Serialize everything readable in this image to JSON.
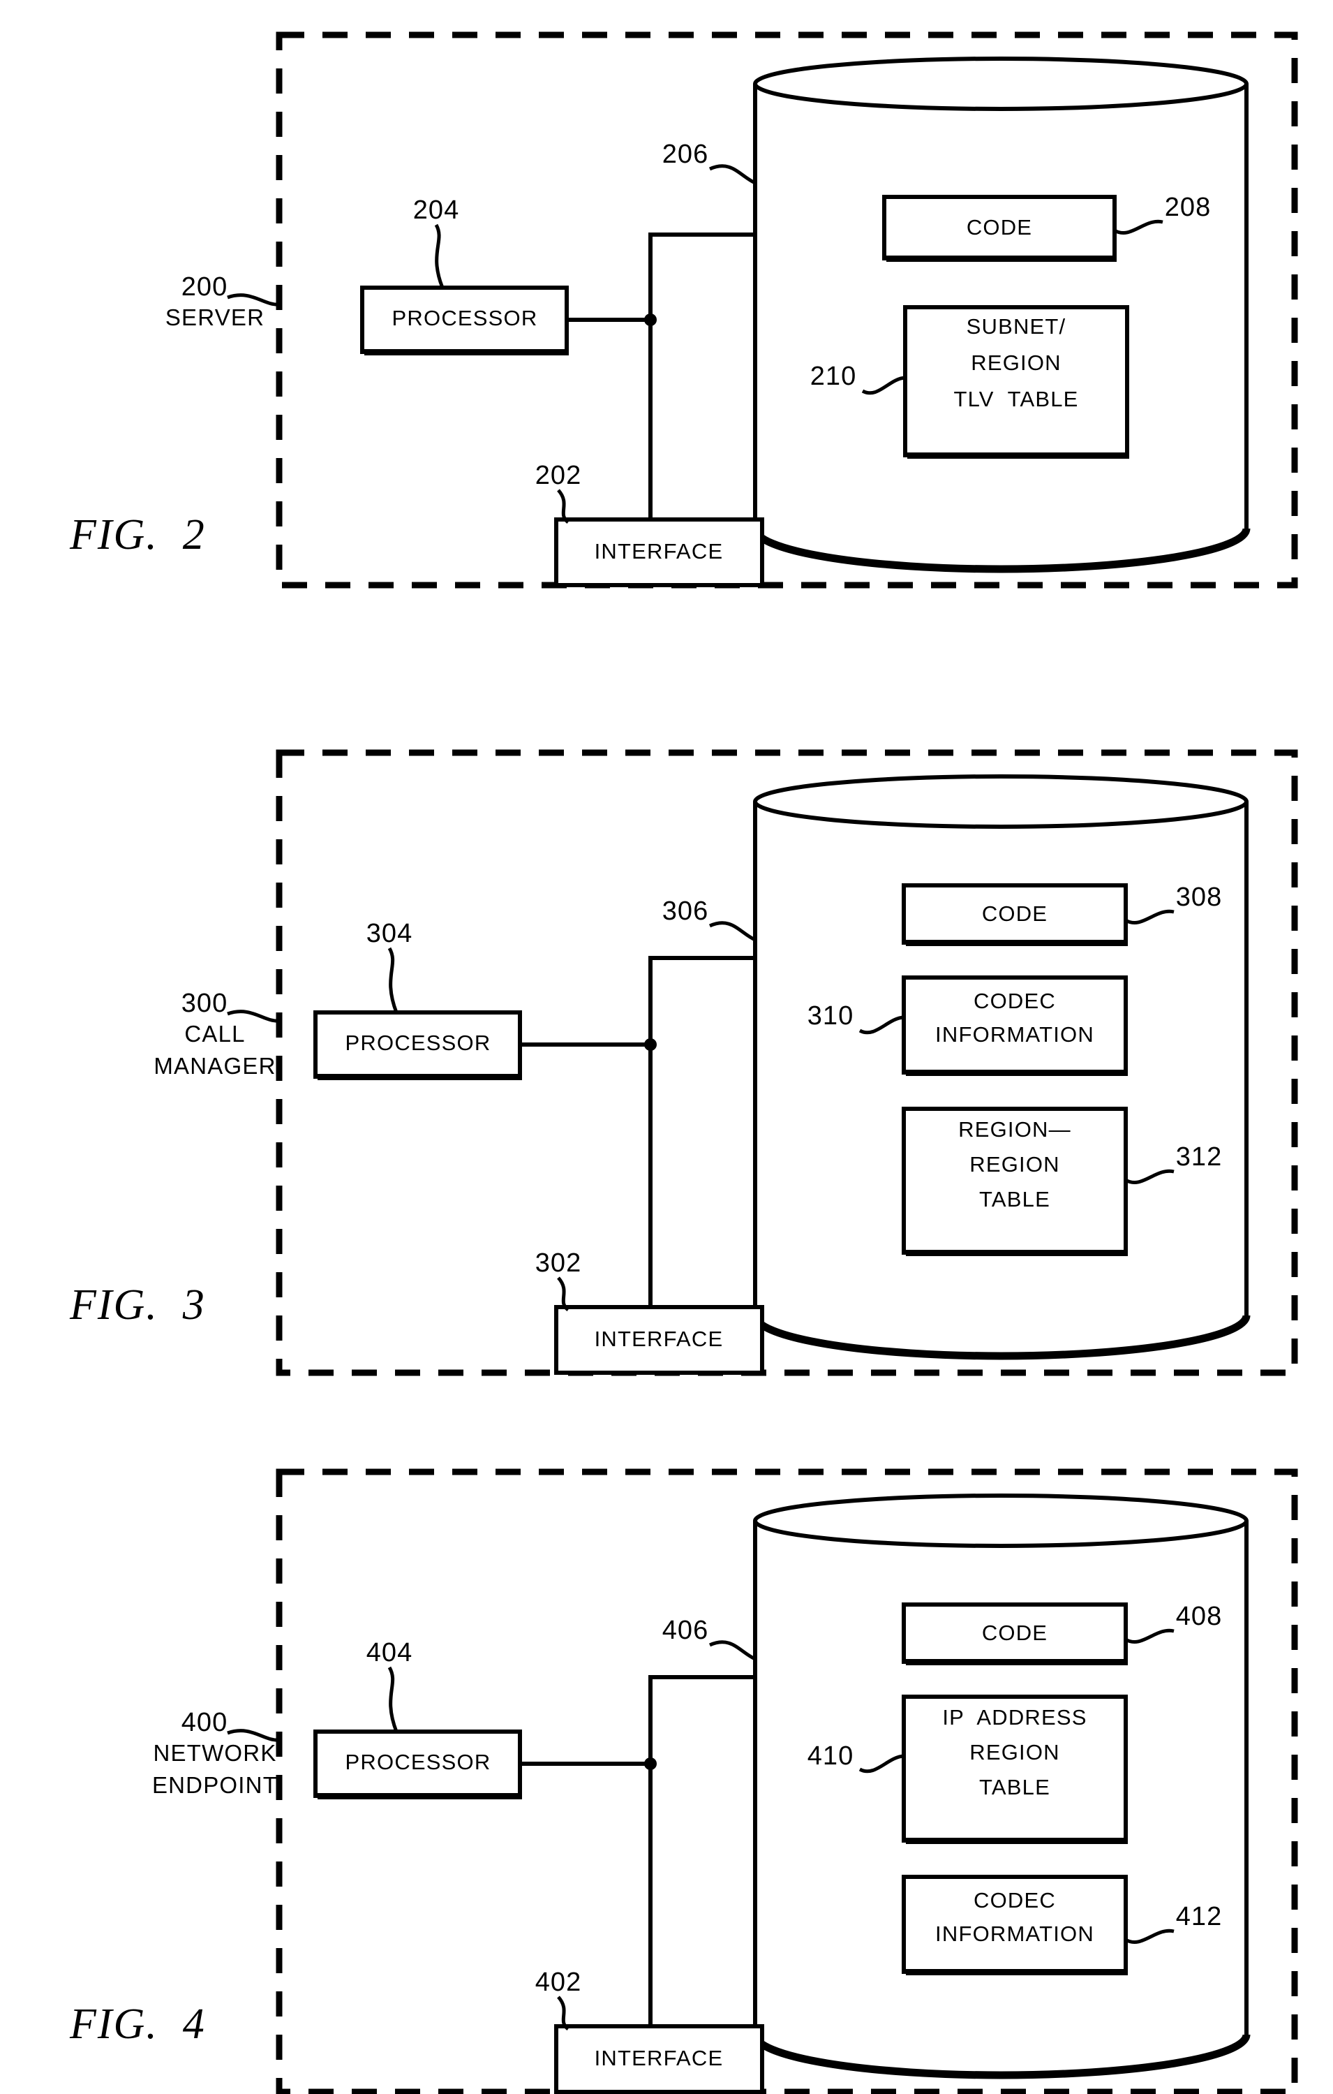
{
  "document": {
    "type": "patent-drawing-sheet",
    "figures": [
      {
        "id": "fig2",
        "caption": "FIG.  2",
        "system": {
          "ref": "200",
          "name_lines": [
            "SERVER"
          ]
        },
        "processor": {
          "ref": "204",
          "label": "PROCESSOR"
        },
        "interface": {
          "ref": "202",
          "label": "INTERFACE"
        },
        "memory": {
          "ref": "206"
        },
        "memory_items": [
          {
            "ref": "208",
            "lines": [
              "CODE"
            ],
            "ref_side": "right"
          },
          {
            "ref": "210",
            "lines": [
              "SUBNET/",
              "REGION",
              "TLV  TABLE"
            ],
            "ref_side": "left"
          }
        ]
      },
      {
        "id": "fig3",
        "caption": "FIG.  3",
        "system": {
          "ref": "300",
          "name_lines": [
            "CALL",
            "MANAGER"
          ]
        },
        "processor": {
          "ref": "304",
          "label": "PROCESSOR"
        },
        "interface": {
          "ref": "302",
          "label": "INTERFACE"
        },
        "memory": {
          "ref": "306"
        },
        "memory_items": [
          {
            "ref": "308",
            "lines": [
              "CODE"
            ],
            "ref_side": "right"
          },
          {
            "ref": "310",
            "lines": [
              "CODEC",
              "INFORMATION"
            ],
            "ref_side": "left"
          },
          {
            "ref": "312",
            "lines": [
              "REGION—",
              "REGION",
              "TABLE"
            ],
            "ref_side": "right"
          }
        ]
      },
      {
        "id": "fig4",
        "caption": "FIG.  4",
        "system": {
          "ref": "400",
          "name_lines": [
            "NETWORK",
            "ENDPOINT"
          ]
        },
        "processor": {
          "ref": "404",
          "label": "PROCESSOR"
        },
        "interface": {
          "ref": "402",
          "label": "INTERFACE"
        },
        "memory": {
          "ref": "406"
        },
        "memory_items": [
          {
            "ref": "408",
            "lines": [
              "CODE"
            ],
            "ref_side": "right"
          },
          {
            "ref": "410",
            "lines": [
              "IP  ADDRESS",
              "REGION",
              "TABLE"
            ],
            "ref_side": "left"
          },
          {
            "ref": "412",
            "lines": [
              "CODEC",
              "INFORMATION"
            ],
            "ref_side": "right"
          }
        ]
      }
    ],
    "colors": {
      "ink": "#000000",
      "paper": "#ffffff"
    }
  }
}
